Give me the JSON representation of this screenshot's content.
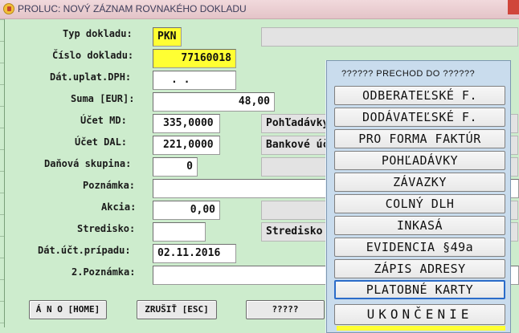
{
  "window": {
    "title": "PROLUC: NOVÝ ZÁZNAM ROVNAKÉHO DOKLADU"
  },
  "form": {
    "typ_label": "Typ dokladu:",
    "typ_value": "PKN",
    "cislo_label": "Číslo dokladu:",
    "cislo_value": "77160018",
    "datuplat_label": "Dát.uplat.DPH:",
    "datuplat_value": ". .",
    "suma_label": "Suma [EUR]:",
    "suma_value": "48,00",
    "ucetmd_label": "Účet MD:",
    "ucetmd_value": "335,0000",
    "ucetmd_desc": "Pohľadávky",
    "ucetdal_label": "Účet DAL:",
    "ucetdal_value": "221,0000",
    "ucetdal_desc": "Bankové úč",
    "dan_label": "Daňová skupina:",
    "dan_value": "0",
    "poz_label": "Poznámka:",
    "poz_value": "",
    "akcia_label": "Akcia:",
    "akcia_value": "0,00",
    "stred_label": "Stredisko:",
    "stred_value": "",
    "stred_desc": "Stredisko",
    "datuct_label": "Dát.účt.prípadu:",
    "datuct_value": "02.11.2016",
    "poz2_label": "2.Poznámka:",
    "poz2_value": ""
  },
  "buttons": {
    "ano": "Á N O [HOME]",
    "zrusit": "ZRUŠIŤ [ESC]",
    "unknown": "?????"
  },
  "menu": {
    "title": "?????? PRECHOD DO ??????",
    "items": [
      "ODBERATEĽSKÉ F.",
      "DODÁVATEĽSKÉ F.",
      "PRO FORMA FAKTÚR",
      "POHĽADÁVKY",
      "ZÁVAZKY",
      "COLNÝ DLH",
      "INKASÁ",
      "EVIDENCIA §49a",
      "ZÁPIS ADRESY",
      "PLATOBNÉ KARTY",
      "UKONČENIE"
    ],
    "selected_index": 9
  },
  "colors": {
    "background": "#cdeccd",
    "highlight_field": "#ffff33",
    "menu_background": "#c9dced"
  }
}
